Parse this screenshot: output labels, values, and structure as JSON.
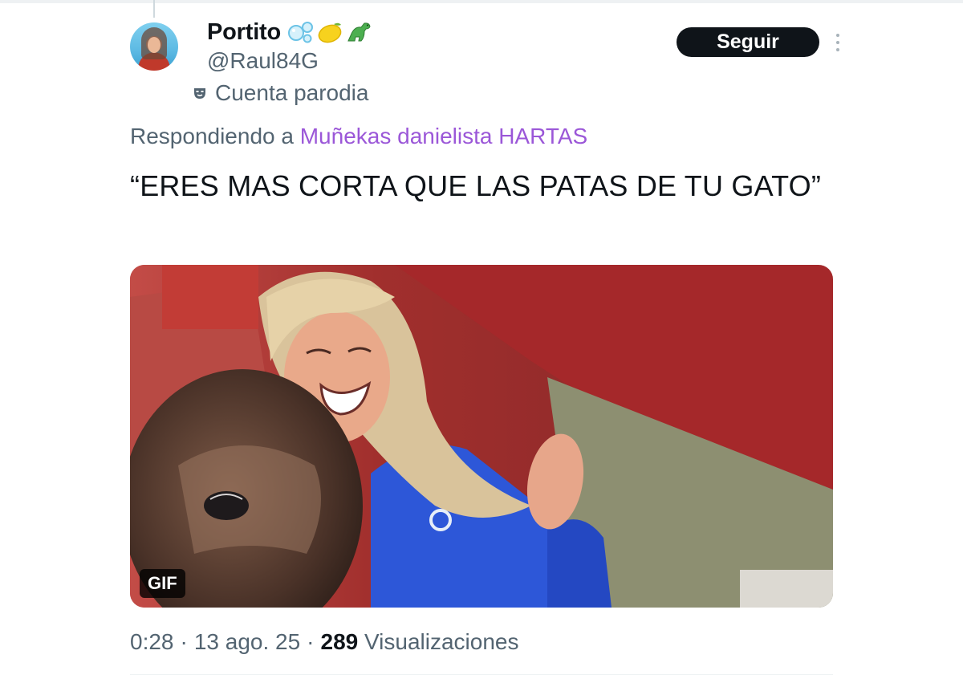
{
  "tweet": {
    "author": {
      "display_name": "Portito",
      "emojis": [
        "bubbles-emoji",
        "lemon-emoji",
        "dinosaur-emoji"
      ],
      "handle": "@Raul84G",
      "parody_label": "Cuenta parodia"
    },
    "follow_label": "Seguir",
    "reply": {
      "prefix": "Respondiendo a ",
      "target": "Muñekas danielista HARTAS"
    },
    "text": "“ERES MAS CORTA QUE LAS PATAS DE TU GATO”",
    "media": {
      "badge": "GIF"
    },
    "meta": {
      "time": "0:28",
      "separator": "·",
      "date": "13 ago. 25",
      "views_count": "289",
      "views_label": "Visualizaciones"
    }
  },
  "colors": {
    "text": "#0f1419",
    "secondary": "#536471",
    "mention": "#9b57d8",
    "button": "#0f1419"
  }
}
